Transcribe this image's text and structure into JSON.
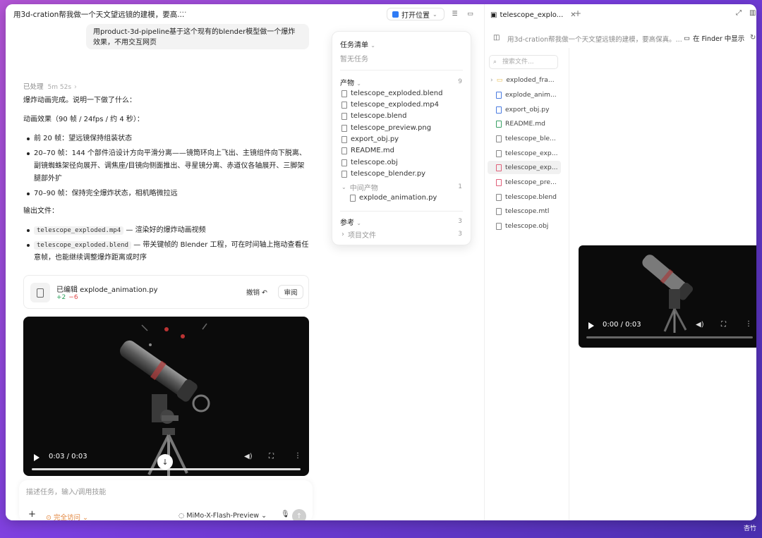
{
  "topbar": {
    "title": "用3d-cration帮我做一个天文望远镜的建模，要高...",
    "more": "···",
    "open_location": "打开位置"
  },
  "chat": {
    "user_message": "用product-3d-pipeline基于这个现有的blender模型做一个爆炸效果，不用交互网页",
    "processed_label": "已处理",
    "processed_time": "5m 52s",
    "intro": "爆炸动画完成。说明一下做了什么：",
    "effect_heading": "动画效果（90 帧 / 24fps / 约 4 秒）：",
    "effect_items": [
      "前 20 帧：望远镜保持组装状态",
      "20–70 帧：144 个部件沿设计方向平滑分离——镜筒环向上飞出、主镜组件向下脱离、副镜蜘蛛架径向展开、调焦座/目镜向侧面推出、寻星镜分离、赤道仪各轴展开、三脚架腿部外扩",
      "70–90 帧：保持完全爆炸状态，相机略微拉远"
    ],
    "output_heading": "输出文件：",
    "outputs": [
      {
        "file": "telescope_exploded.mp4",
        "desc": " — 渲染好的爆炸动画视频"
      },
      {
        "file": "telescope_exploded.blend",
        "desc": " — 带关键帧的 Blender 工程，可在时间轴上拖动查看任意帧，也能继续调整爆炸距离或时序"
      }
    ],
    "edit_card": {
      "title": "已编辑 explode_animation.py",
      "added": "+2",
      "removed": "−6",
      "undo": "撤销",
      "review": "审阅"
    },
    "video": {
      "time": "0:03 / 0:03",
      "progress": 1.0
    }
  },
  "composer": {
    "placeholder": "描述任务，输入/调用技能",
    "access": "完全访问",
    "model": "MiMo-X-Flash-Preview"
  },
  "popover": {
    "tasks_label": "任务清单",
    "tasks_empty": "暂无任务",
    "artifacts_label": "产物",
    "artifacts_count": "9",
    "artifacts": [
      "telescope_exploded.blend",
      "telescope_exploded.mp4",
      "telescope.blend",
      "telescope_preview.png",
      "export_obj.py",
      "README.md",
      "telescope.obj",
      "telescope_blender.py"
    ],
    "intermediate_label": "中间产物",
    "intermediate_count": "1",
    "intermediate_file": "explode_animation.py",
    "refs_label": "参考",
    "refs_count": "3",
    "project_files_label": "项目文件",
    "project_files_count": "3"
  },
  "right": {
    "tab_title": "telescope_explo...",
    "path": "用3d-cration帮我做一个天文望远镜的建模，要高保真。...",
    "finder_label": "在 Finder 中显示",
    "search_placeholder": "搜索文件...",
    "tree": [
      {
        "name": "exploded_fra...",
        "type": "folder",
        "selected": false
      },
      {
        "name": "explode_anim...",
        "type": "file",
        "selected": false
      },
      {
        "name": "export_obj.py",
        "type": "file",
        "selected": false
      },
      {
        "name": "README.md",
        "type": "md",
        "selected": false
      },
      {
        "name": "telescope_ble...",
        "type": "file",
        "selected": false
      },
      {
        "name": "telescope_exp...",
        "type": "file",
        "selected": false
      },
      {
        "name": "telescope_exp...",
        "type": "media",
        "selected": true
      },
      {
        "name": "telescope_pre...",
        "type": "media",
        "selected": false
      },
      {
        "name": "telescope.blend",
        "type": "file",
        "selected": false
      },
      {
        "name": "telescope.mtl",
        "type": "file",
        "selected": false
      },
      {
        "name": "telescope.obj",
        "type": "file",
        "selected": false
      }
    ],
    "video": {
      "time": "0:00 / 0:03",
      "progress": 0
    }
  },
  "desktop_caption": "杏竹",
  "colors": {
    "accent_blue": "#2f7bf5",
    "added_green": "#2aa05a",
    "removed_red": "#e04848",
    "warning_orange": "#e2863f"
  }
}
